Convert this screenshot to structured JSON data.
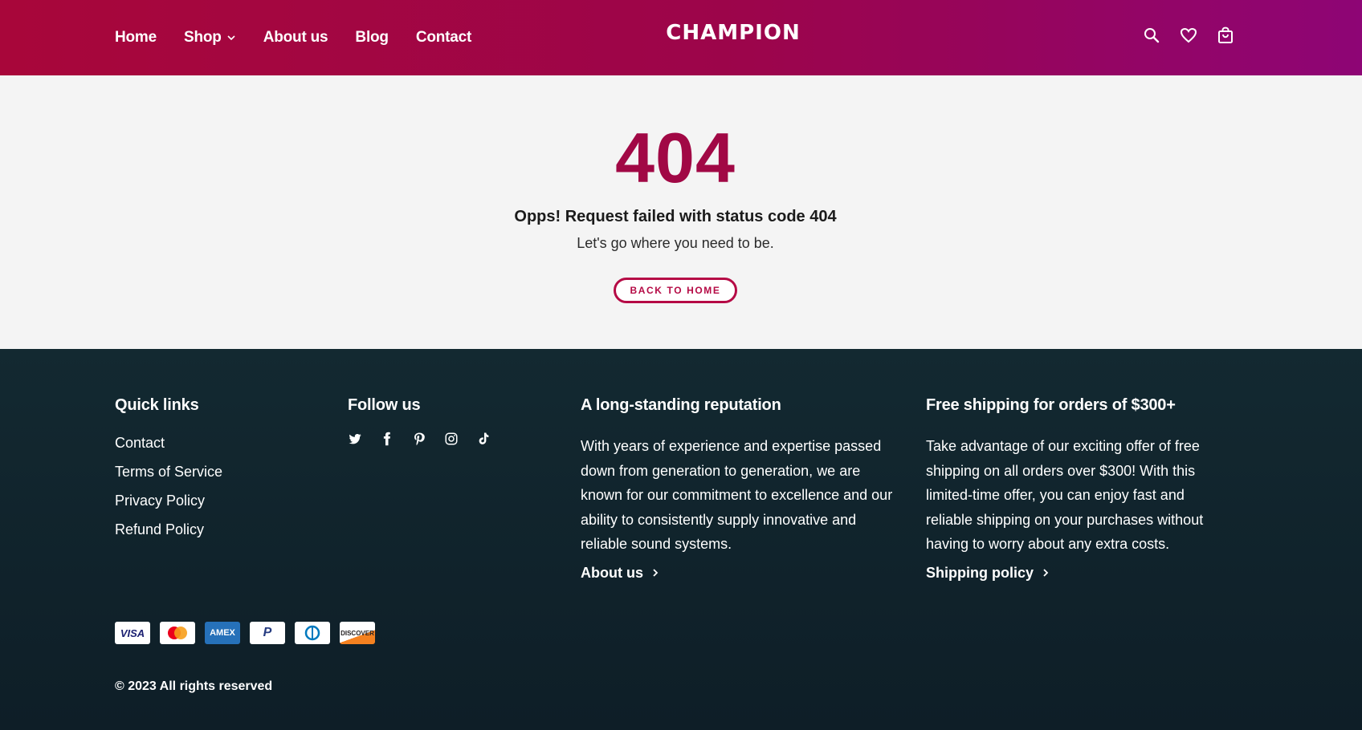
{
  "header": {
    "nav": [
      {
        "label": "Home"
      },
      {
        "label": "Shop"
      },
      {
        "label": "About us"
      },
      {
        "label": "Blog"
      },
      {
        "label": "Contact"
      }
    ],
    "logo": "CHAMPION",
    "icons": [
      "search-icon",
      "heart-icon",
      "shopping-bag-icon"
    ]
  },
  "main": {
    "code": "404",
    "title": "Opps! Request failed with status code 404",
    "subtitle": "Let's go where you need to be.",
    "button": "BACK TO HOME"
  },
  "footer": {
    "quick_links": {
      "heading": "Quick links",
      "items": [
        "Contact",
        "Terms of Service",
        "Privacy Policy",
        "Refund Policy"
      ]
    },
    "follow": {
      "heading": "Follow us",
      "icons": [
        "twitter-icon",
        "facebook-icon",
        "pinterest-icon",
        "instagram-icon",
        "tiktok-icon"
      ]
    },
    "reputation": {
      "heading": "A long-standing reputation",
      "text": "With years of experience and expertise passed down from generation to generation, we are known for our commitment to excellence and our ability to consistently supply innovative and reliable sound systems.",
      "link": "About us"
    },
    "shipping": {
      "heading": "Free shipping for orders of $300+",
      "text": "Take advantage of our exciting offer of free shipping on all orders over $300! With this limited-time offer, you can enjoy fast and reliable shipping on your purchases without having to worry about any extra costs.",
      "link": "Shipping policy"
    },
    "payments": [
      "VISA",
      "Mastercard",
      "AMEX",
      "PayPal",
      "Diners Club",
      "DISCOVER"
    ],
    "copyright": "© 2023 All rights reserved"
  },
  "colors": {
    "brand": "#a8063a",
    "brand_end": "#8e0575",
    "footer_bg": "#132931"
  }
}
